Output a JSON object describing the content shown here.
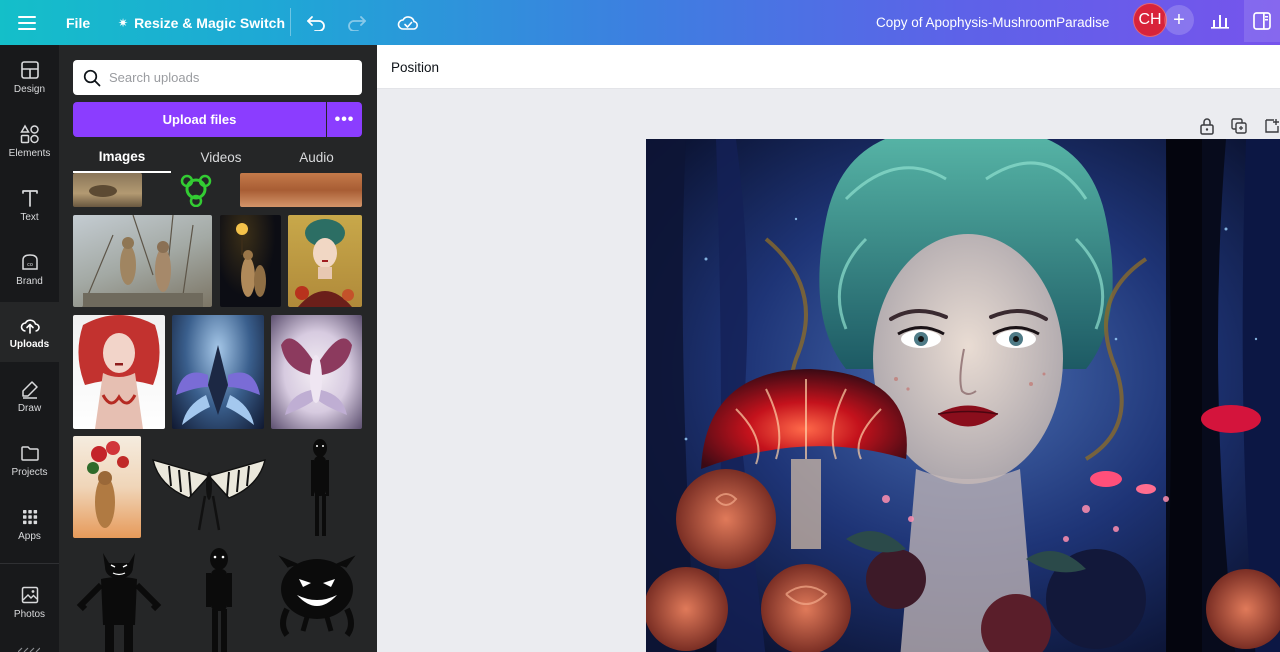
{
  "topbar": {
    "file_label": "File",
    "resize_label": "Resize & Magic Switch",
    "document_title": "Copy of Apophysis-MushroomParadise",
    "avatar_initials": "CH",
    "gradient_colors": [
      "#14bfc9",
      "#3d7fe0",
      "#7654ec"
    ]
  },
  "rail": {
    "items": [
      {
        "label": "Design",
        "icon": "layout-icon"
      },
      {
        "label": "Elements",
        "icon": "shapes-icon"
      },
      {
        "label": "Text",
        "icon": "text-icon"
      },
      {
        "label": "Brand",
        "icon": "brand-icon"
      },
      {
        "label": "Uploads",
        "icon": "cloud-upload-icon",
        "active": true
      },
      {
        "label": "Draw",
        "icon": "pen-icon"
      },
      {
        "label": "Projects",
        "icon": "folder-icon"
      },
      {
        "label": "Apps",
        "icon": "apps-grid-icon"
      },
      {
        "label": "Photos",
        "icon": "photo-icon"
      }
    ]
  },
  "panel": {
    "search_placeholder": "Search uploads",
    "upload_button_label": "Upload files",
    "more_label": "•••",
    "tabs": [
      {
        "label": "Images",
        "active": true
      },
      {
        "label": "Videos",
        "active": false
      },
      {
        "label": "Audio",
        "active": false
      }
    ],
    "accent_color": "#8b3dff"
  },
  "context_bar": {
    "position_label": "Position"
  }
}
